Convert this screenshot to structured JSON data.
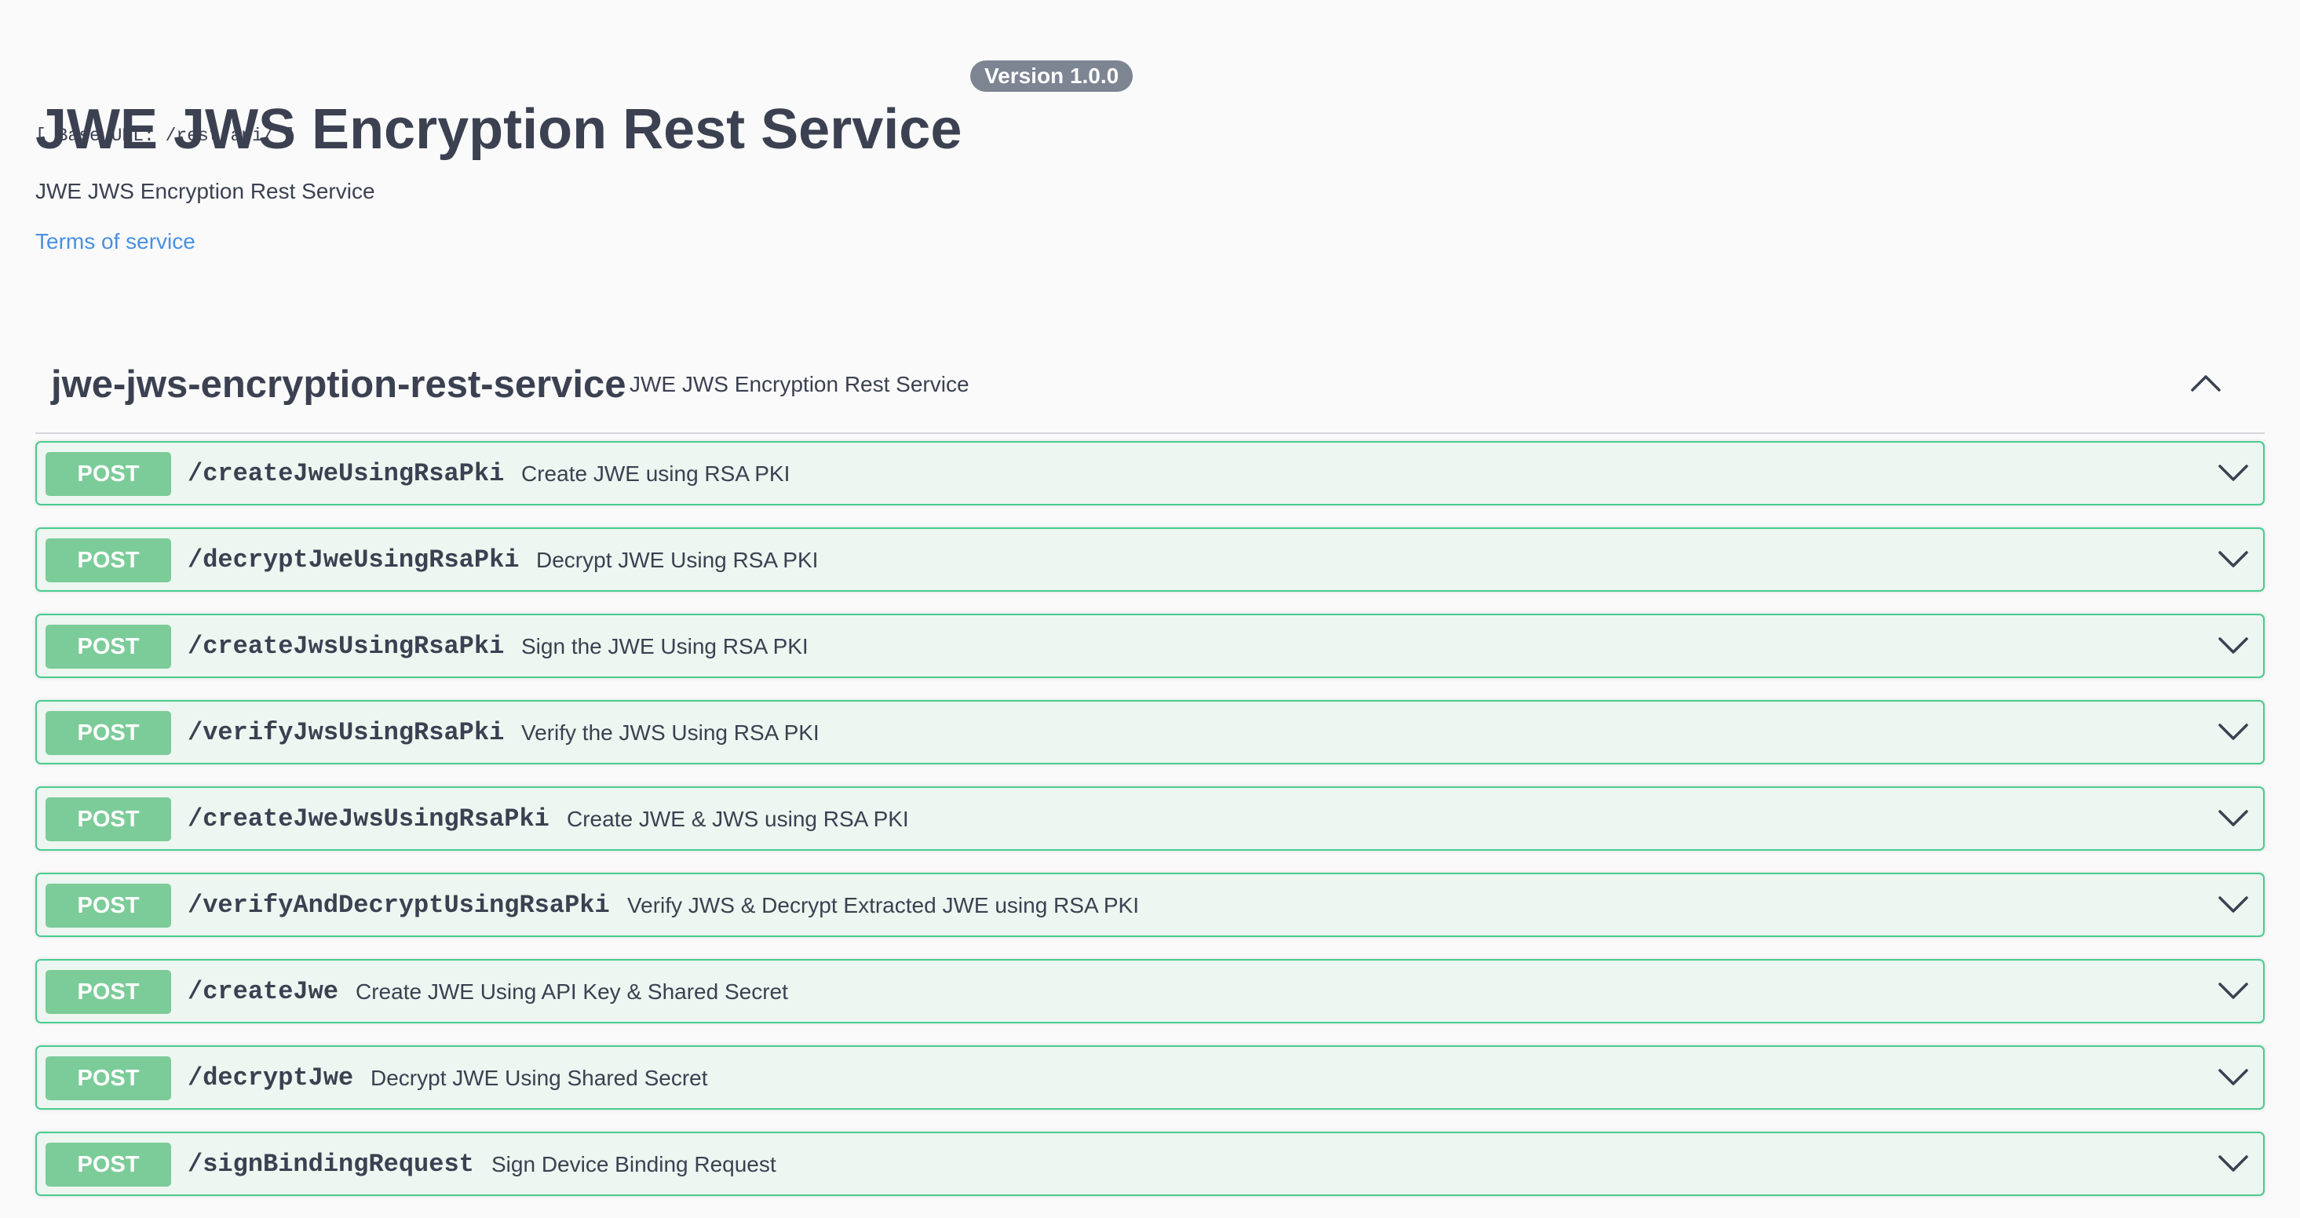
{
  "info": {
    "title": "JWE JWS Encryption Rest Service",
    "version_badge": "Version 1.0.0",
    "base_url": "[ Base URL: /rest/api/ ]",
    "description": "JWE JWS Encryption Rest Service",
    "terms_link": "Terms of service"
  },
  "tag": {
    "name": "jwe-jws-encryption-rest-service",
    "description": "JWE JWS Encryption Rest Service",
    "expanded": true,
    "toggle_icon": "chevron-up-icon"
  },
  "colors": {
    "post_border": "#49cc90",
    "post_background": "#edf6f0",
    "post_badge": "#7ccc99",
    "link": "#4990e2",
    "text": "#3b4151"
  },
  "operations": [
    {
      "method": "POST",
      "path": "/createJweUsingRsaPki",
      "summary": "Create JWE using RSA PKI",
      "toggle_icon": "chevron-down-icon"
    },
    {
      "method": "POST",
      "path": "/decryptJweUsingRsaPki",
      "summary": "Decrypt JWE Using RSA PKI",
      "toggle_icon": "chevron-down-icon"
    },
    {
      "method": "POST",
      "path": "/createJwsUsingRsaPki",
      "summary": "Sign the JWE Using RSA PKI",
      "toggle_icon": "chevron-down-icon"
    },
    {
      "method": "POST",
      "path": "/verifyJwsUsingRsaPki",
      "summary": "Verify the JWS Using RSA PKI",
      "toggle_icon": "chevron-down-icon"
    },
    {
      "method": "POST",
      "path": "/createJweJwsUsingRsaPki",
      "summary": "Create JWE & JWS using RSA PKI",
      "toggle_icon": "chevron-down-icon"
    },
    {
      "method": "POST",
      "path": "/verifyAndDecryptUsingRsaPki",
      "summary": "Verify JWS & Decrypt Extracted JWE using RSA PKI",
      "toggle_icon": "chevron-down-icon"
    },
    {
      "method": "POST",
      "path": "/createJwe",
      "summary": "Create JWE Using API Key & Shared Secret",
      "toggle_icon": "chevron-down-icon"
    },
    {
      "method": "POST",
      "path": "/decryptJwe",
      "summary": "Decrypt JWE Using Shared Secret",
      "toggle_icon": "chevron-down-icon"
    },
    {
      "method": "POST",
      "path": "/signBindingRequest",
      "summary": "Sign Device Binding Request",
      "toggle_icon": "chevron-down-icon"
    }
  ]
}
